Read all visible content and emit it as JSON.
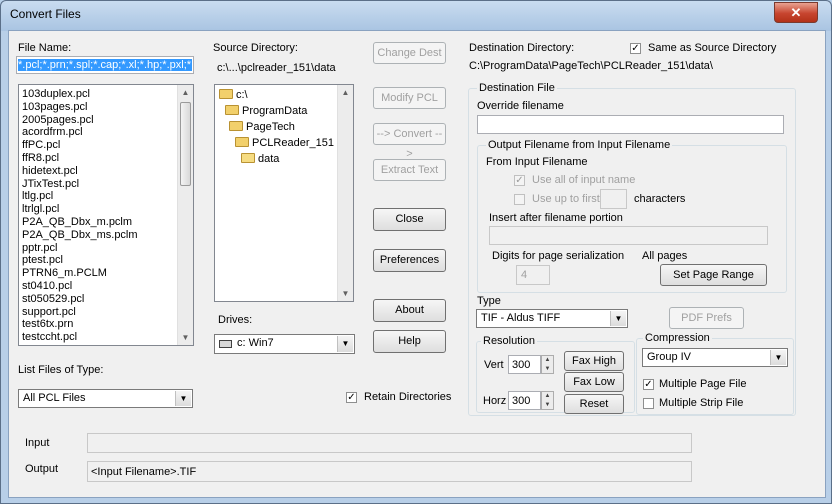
{
  "window": {
    "title": "Convert Files",
    "close_glyph": "✕"
  },
  "file_name": {
    "label": "File Name:",
    "value": "*.pcl;*.prn;*.spl;*.cap;*.xl;*.hp;*.pxl;*.lis",
    "files": [
      "103duplex.pcl",
      "103pages.pcl",
      "2005pages.pcl",
      "acordfrm.pcl",
      "ffPC.pcl",
      "ffR8.pcl",
      "hidetext.pcl",
      "JTixTest.pcl",
      "ltlg.pcl",
      "ltrlgl.pcl",
      "P2A_QB_Dbx_m.pclm",
      "P2A_QB_Dbx_ms.pclm",
      "pptr.pcl",
      "ptest.pcl",
      "PTRN6_m.PCLM",
      "st0410.pcl",
      "st050529.pcl",
      "support.pcl",
      "test6tx.prn",
      "testccht.pcl"
    ]
  },
  "list_type": {
    "label": "List Files of Type:",
    "value": "All PCL Files"
  },
  "source": {
    "label": "Source Directory:",
    "path": "c:\\...\\pclreader_151\\data",
    "tree": [
      "c:\\",
      "ProgramData",
      "PageTech",
      "PCLReader_151",
      "data"
    ]
  },
  "drives": {
    "label": "Drives:",
    "value": "c: Win7"
  },
  "buttons": {
    "change_dest": "Change Dest",
    "modify_pcl": "Modify PCL",
    "convert": "--> Convert -->",
    "extract_text": "Extract Text",
    "close": "Close",
    "preferences": "Preferences",
    "about": "About",
    "help": "Help"
  },
  "retain_dirs": {
    "label": "Retain Directories",
    "checked": true
  },
  "destination": {
    "label": "Destination Directory:",
    "same_as_source": "Same as Source Directory",
    "path": "C:\\ProgramData\\PageTech\\PCLReader_151\\data\\"
  },
  "dest_file": {
    "group": "Destination File",
    "override_label": "Override filename",
    "override_value": "",
    "output_group": "Output Filename from Input Filename",
    "from_input": "From Input Filename",
    "use_all": "Use all of input name",
    "use_up_to": "Use up to first",
    "characters": "characters",
    "insert_after": "Insert after filename portion",
    "digits_label": "Digits for page serialization",
    "digits_value": "4",
    "all_pages": "All pages",
    "set_page_range": "Set Page Range"
  },
  "type": {
    "label": "Type",
    "value": "TIF - Aldus TIFF",
    "pdf_prefs": "PDF Prefs"
  },
  "resolution": {
    "group": "Resolution",
    "vert_label": "Vert",
    "vert_value": "300",
    "horz_label": "Horz",
    "horz_value": "300",
    "fax_high": "Fax High",
    "fax_low": "Fax Low",
    "reset": "Reset"
  },
  "compression": {
    "group": "Compression",
    "value": "Group IV",
    "multi_page": "Multiple Page File",
    "multi_strip": "Multiple Strip File"
  },
  "io": {
    "input_label": "Input",
    "input_value": "",
    "output_label": "Output",
    "output_value": "<Input Filename>.TIF"
  }
}
